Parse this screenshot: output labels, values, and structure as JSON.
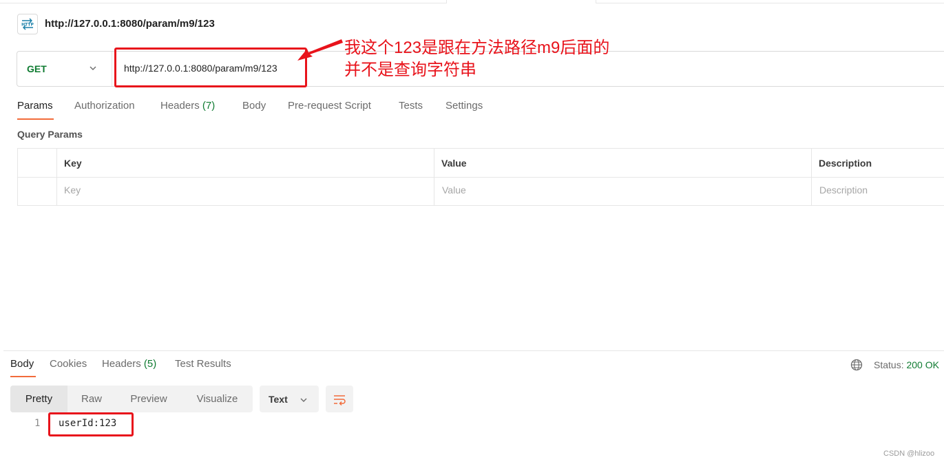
{
  "request": {
    "title": "http://127.0.0.1:8080/param/m9/123",
    "method": "GET",
    "url": "http://127.0.0.1:8080/param/m9/123",
    "icon": "http-icon"
  },
  "annotation": {
    "line1": "我这个123是跟在方法路径m9后面的",
    "line2": "并不是查询字符串"
  },
  "request_tabs": [
    {
      "label": "Params",
      "count": ""
    },
    {
      "label": "Authorization",
      "count": ""
    },
    {
      "label": "Headers",
      "count": "(7)"
    },
    {
      "label": "Body",
      "count": ""
    },
    {
      "label": "Pre-request Script",
      "count": ""
    },
    {
      "label": "Tests",
      "count": ""
    },
    {
      "label": "Settings",
      "count": ""
    }
  ],
  "query_params": {
    "title": "Query Params",
    "headers": [
      "Key",
      "Value",
      "Description"
    ],
    "placeholders": [
      "Key",
      "Value",
      "Description"
    ]
  },
  "response_tabs": [
    {
      "label": "Body",
      "count": ""
    },
    {
      "label": "Cookies",
      "count": ""
    },
    {
      "label": "Headers",
      "count": "(5)"
    },
    {
      "label": "Test Results",
      "count": ""
    }
  ],
  "status": {
    "label": "Status:",
    "value": "200 OK"
  },
  "format": {
    "options": [
      "Pretty",
      "Raw",
      "Preview",
      "Visualize"
    ],
    "type_select": "Text"
  },
  "body": {
    "line_number": "1",
    "content": "userId:123"
  },
  "watermark": "CSDN @hlizoo",
  "colors": {
    "accent": "#f26b3a",
    "get_method": "#0f7b31",
    "annotation": "#e8131b"
  }
}
